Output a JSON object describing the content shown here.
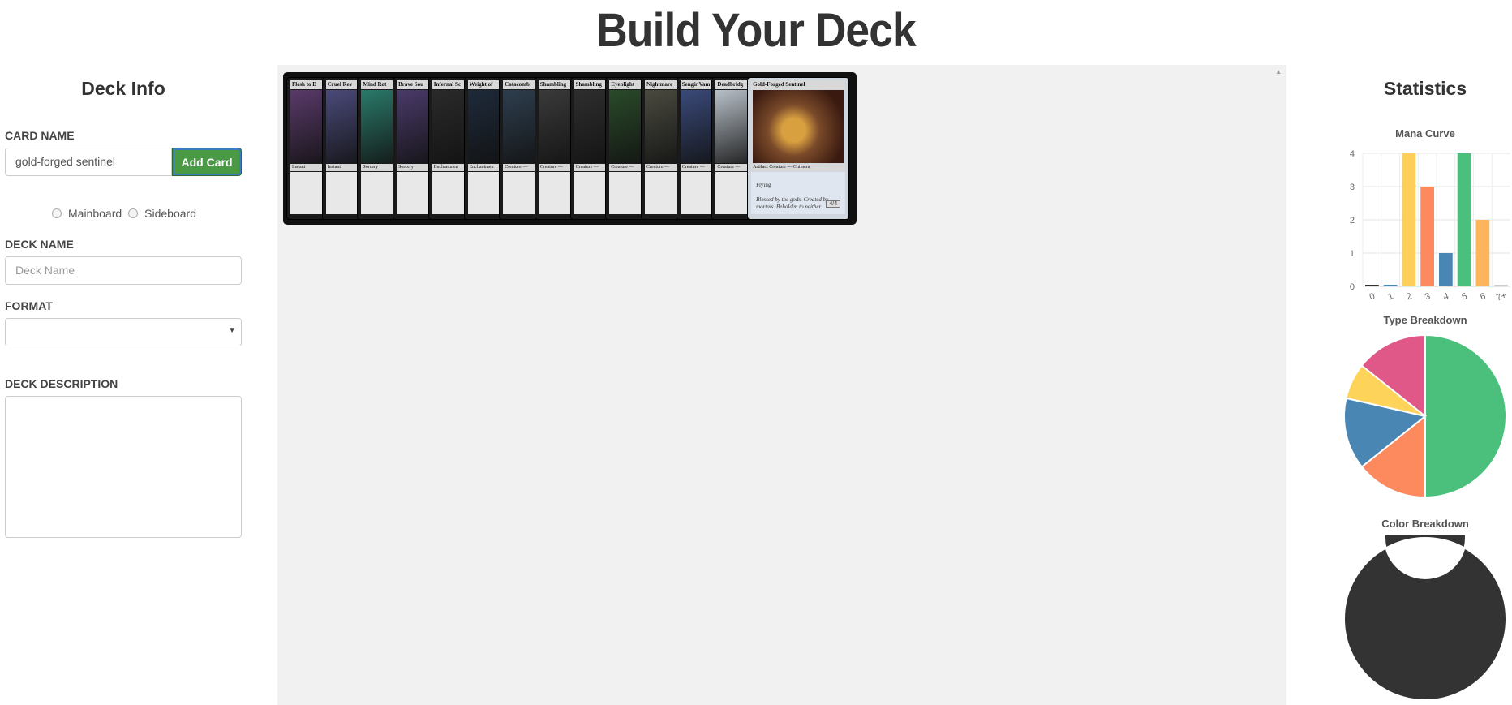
{
  "page": {
    "title": "Build Your Deck"
  },
  "deck_info": {
    "heading": "Deck Info",
    "card_name_label": "CARD NAME",
    "card_name_value": "gold-forged sentinel",
    "add_card_label": "Add Card",
    "radio_mainboard": "Mainboard",
    "radio_sideboard": "Sideboard",
    "deck_name_label": "DECK NAME",
    "deck_name_placeholder": "Deck Name",
    "format_label": "FORMAT",
    "format_value": "",
    "description_label": "DECK DESCRIPTION"
  },
  "deck": {
    "cards": [
      {
        "name": "Flesh to D",
        "type": "Instant",
        "art": "#5a3a6a"
      },
      {
        "name": "Cruel Rev",
        "type": "Instant",
        "art": "#4a4a7a"
      },
      {
        "name": "Mind Rot",
        "type": "Sorcery",
        "art": "#2a7a6a"
      },
      {
        "name": "Brave Sou",
        "type": "Sorcery",
        "art": "#4a3a6a"
      },
      {
        "name": "Infernal Sc",
        "type": "Enchantmen",
        "art": "#2a2a2a"
      },
      {
        "name": "Weight of",
        "type": "Enchantmen",
        "art": "#1e2a3a"
      },
      {
        "name": "Catacomb",
        "type": "Creature —",
        "art": "#2e3e4e"
      },
      {
        "name": "Shambling",
        "type": "Creature —",
        "art": "#3a3a3a"
      },
      {
        "name": "Shambling",
        "type": "Creature —",
        "art": "#2e2e2e"
      },
      {
        "name": "Eyeblight",
        "type": "Creature —",
        "art": "#2a4a2a"
      },
      {
        "name": "Nightmare",
        "type": "Creature —",
        "art": "#4a4a40"
      },
      {
        "name": "Sengir Vam",
        "type": "Creature —",
        "art": "#3a4a7a"
      },
      {
        "name": "Deadbridg",
        "type": "Creature —",
        "art": "#b8c0c8"
      }
    ],
    "featured_card": {
      "name": "Gold-Forged Sentinel",
      "type": "Artifact Creature — Chimera",
      "ability": "Flying",
      "flavor": "Blessed by the gods. Created by mortals. Beholden to neither.",
      "pt": "4/4",
      "art": "#7a4a2a"
    }
  },
  "statistics": {
    "heading": "Statistics",
    "mana_curve_title": "Mana Curve",
    "type_breakdown_title": "Type Breakdown",
    "color_breakdown_title": "Color Breakdown"
  },
  "chart_data": [
    {
      "type": "bar",
      "title": "Mana Curve",
      "categories": [
        "0",
        "1",
        "2",
        "3",
        "4",
        "5",
        "6",
        "7+"
      ],
      "values": [
        0,
        0,
        4,
        3,
        1,
        4,
        2,
        0
      ],
      "colors": [
        "#333333",
        "#4a86b4",
        "#fdcf5a",
        "#fd8a5f",
        "#4a86b4",
        "#4ac07c",
        "#fdb45a",
        "#cccccc"
      ],
      "ylim": [
        0,
        4
      ],
      "yticks": [
        "0",
        "1",
        "2",
        "3",
        "4"
      ],
      "grid": true
    },
    {
      "type": "pie",
      "title": "Type Breakdown",
      "values": [
        7,
        2,
        2,
        1,
        2
      ],
      "colors": [
        "#4ac07c",
        "#fd8a5f",
        "#4a86b4",
        "#fdd35a",
        "#e05888"
      ]
    },
    {
      "type": "pie",
      "title": "Color Breakdown",
      "donut": true,
      "values": [
        1
      ],
      "colors": [
        "#333333"
      ]
    }
  ]
}
